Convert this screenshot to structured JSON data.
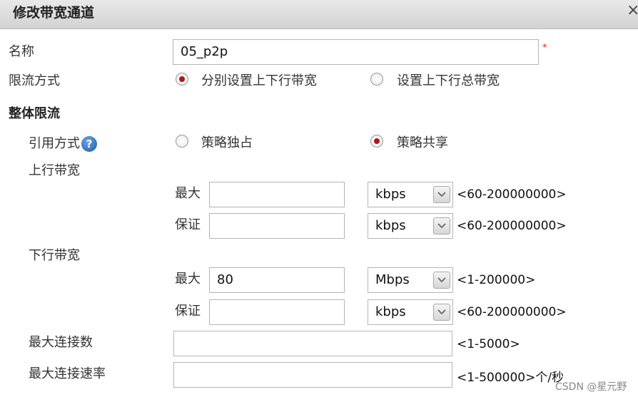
{
  "dialog": {
    "title": "修改带宽通道",
    "close_icon": "×"
  },
  "fields": {
    "name_label": "名称",
    "name_value": "05_p2p",
    "required_mark": "*",
    "limit_mode_label": "限流方式",
    "limit_mode_options": [
      "分别设置上下行带宽",
      "设置上下行总带宽"
    ],
    "limit_mode_selected": 0
  },
  "overall": {
    "section_title": "整体限流",
    "ref_mode_label": "引用方式",
    "ref_mode_options": [
      "策略独占",
      "策略共享"
    ],
    "ref_mode_selected": 1,
    "upstream_label": "上行带宽",
    "downstream_label": "下行带宽",
    "max_label": "最大",
    "guarantee_label": "保证",
    "up_max": {
      "value": "",
      "unit": "kbps",
      "range": "<60-200000000>"
    },
    "up_guarantee": {
      "value": "",
      "unit": "kbps",
      "range": "<60-200000000>"
    },
    "down_max": {
      "value": "80",
      "unit": "Mbps",
      "range": "<1-200000>"
    },
    "down_guarantee": {
      "value": "",
      "unit": "kbps",
      "range": "<60-200000000>"
    },
    "max_conn_label": "最大连接数",
    "max_conn_value": "",
    "max_conn_range": "<1-5000>",
    "max_rate_label": "最大连接速率",
    "max_rate_value": "",
    "max_rate_range": "<1-500000>个/秒"
  },
  "watermark": "CSDN @星元野",
  "colors": {
    "radio_selected": "#b0161c",
    "required": "#e02020",
    "help_icon": "#1f5aa8"
  }
}
